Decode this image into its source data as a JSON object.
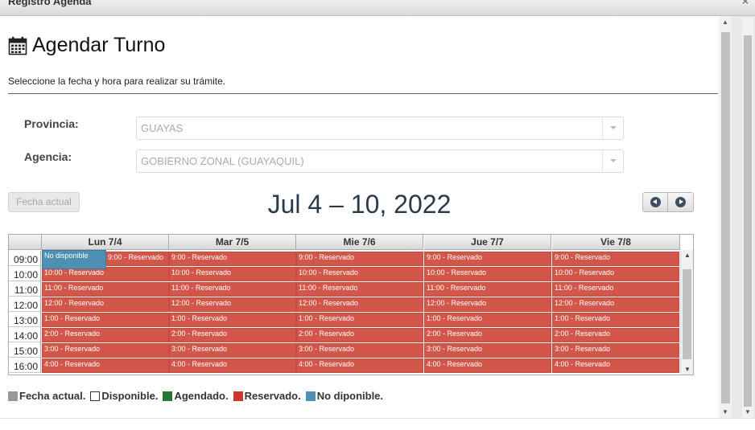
{
  "window": {
    "title": "Registro Agenda",
    "close_glyph": "×"
  },
  "page": {
    "title": "Agendar Turno",
    "subtitle": "Seleccione la fecha y hora para realizar su trámite."
  },
  "form": {
    "provincia": {
      "label": "Provincia:",
      "value": "GUAYAS"
    },
    "agencia": {
      "label": "Agencia:",
      "value": "GOBIERNO ZONAL (GUAYAQUIL)"
    }
  },
  "toolbar": {
    "today_label": "Fecha actual",
    "range_title": "Jul 4 – 10, 2022"
  },
  "calendar": {
    "days": [
      "Lun 7/4",
      "Mar 7/5",
      "Mie 7/6",
      "Jue 7/7",
      "Vie 7/8"
    ],
    "hours": [
      "09:00",
      "10:00",
      "11:00",
      "12:00",
      "13:00",
      "14:00",
      "15:00",
      "16:00"
    ],
    "slot_labels": [
      "9:00 - Reservado",
      "10:00 - Reservado",
      "11:00 - Reservado",
      "12:00 - Reservado",
      "1:00 - Reservado",
      "2:00 - Reservado",
      "3:00 - Reservado",
      "4:00 - Reservado"
    ],
    "not_available_label": "No disponible"
  },
  "legend": [
    {
      "label": "Fecha actual.",
      "color": "#999999"
    },
    {
      "label": "Disponible.",
      "color": "#ffffff"
    },
    {
      "label": "Agendado.",
      "color": "#1e7a34"
    },
    {
      "label": "Reservado.",
      "color": "#c8382b"
    },
    {
      "label": "No diponible.",
      "color": "#4e90b4"
    }
  ],
  "colors": {
    "reserved": "#d2574a",
    "not_available": "#4e90b4",
    "accent": "#2a4f82"
  },
  "icons": {
    "title_icon": "calendar-icon",
    "prev": "prev-circle-icon",
    "next": "next-circle-icon"
  }
}
